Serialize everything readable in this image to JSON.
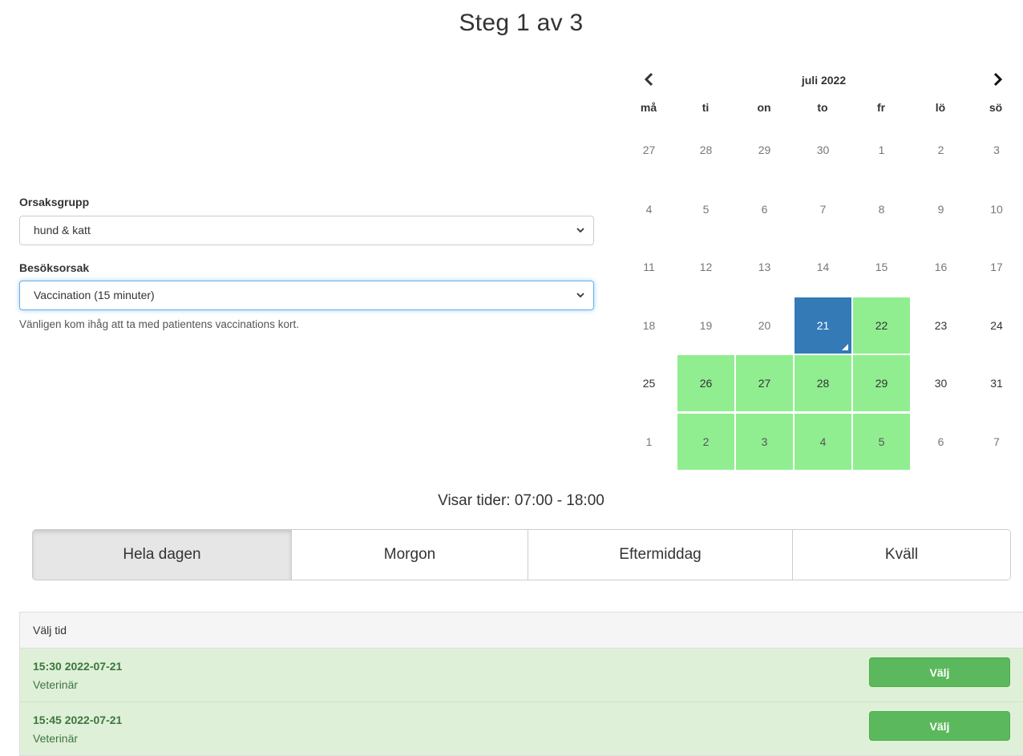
{
  "page": {
    "title": "Steg 1 av 3"
  },
  "form": {
    "group_label": "Orsaksgrupp",
    "group_value": "hund & katt",
    "reason_label": "Besöksorsak",
    "reason_value": "Vaccination (15 minuter)",
    "help_text": "Vänligen kom ihåg att ta med patientens vaccinations kort."
  },
  "calendar": {
    "month": "juli 2022",
    "prev_icon": "chevron-left-icon",
    "next_icon": "chevron-right-icon",
    "weekdays": [
      "må",
      "ti",
      "on",
      "to",
      "fr",
      "lö",
      "sö"
    ],
    "weeks": [
      [
        {
          "d": "27",
          "s": "other"
        },
        {
          "d": "28",
          "s": "other"
        },
        {
          "d": "29",
          "s": "other"
        },
        {
          "d": "30",
          "s": "other"
        },
        {
          "d": "1",
          "s": "other"
        },
        {
          "d": "2",
          "s": "other"
        },
        {
          "d": "3",
          "s": "other"
        }
      ],
      [
        {
          "d": "4",
          "s": "other"
        },
        {
          "d": "5",
          "s": "other"
        },
        {
          "d": "6",
          "s": "other"
        },
        {
          "d": "7",
          "s": "other"
        },
        {
          "d": "8",
          "s": "other"
        },
        {
          "d": "9",
          "s": "other"
        },
        {
          "d": "10",
          "s": "other"
        }
      ],
      [
        {
          "d": "11",
          "s": "other"
        },
        {
          "d": "12",
          "s": "other"
        },
        {
          "d": "13",
          "s": "other"
        },
        {
          "d": "14",
          "s": "other"
        },
        {
          "d": "15",
          "s": "other"
        },
        {
          "d": "16",
          "s": "other"
        },
        {
          "d": "17",
          "s": "other"
        }
      ],
      [
        {
          "d": "18",
          "s": "other"
        },
        {
          "d": "19",
          "s": "other"
        },
        {
          "d": "20",
          "s": "other"
        },
        {
          "d": "21",
          "s": "selected"
        },
        {
          "d": "22",
          "s": "avail"
        },
        {
          "d": "23",
          "s": "cur"
        },
        {
          "d": "24",
          "s": "cur"
        }
      ],
      [
        {
          "d": "25",
          "s": "cur"
        },
        {
          "d": "26",
          "s": "avail"
        },
        {
          "d": "27",
          "s": "avail"
        },
        {
          "d": "28",
          "s": "avail"
        },
        {
          "d": "29",
          "s": "avail"
        },
        {
          "d": "30",
          "s": "cur"
        },
        {
          "d": "31",
          "s": "cur"
        }
      ],
      [
        {
          "d": "1",
          "s": "other"
        },
        {
          "d": "2",
          "s": "avail other"
        },
        {
          "d": "3",
          "s": "avail other"
        },
        {
          "d": "4",
          "s": "avail other"
        },
        {
          "d": "5",
          "s": "avail other"
        },
        {
          "d": "6",
          "s": "other"
        },
        {
          "d": "7",
          "s": "other"
        }
      ]
    ],
    "colors": {
      "available": "#90ee90",
      "selected": "#337ab7"
    }
  },
  "times": {
    "showing": "Visar tider: 07:00 - 18:00",
    "filters": [
      {
        "label": "Hela dagen",
        "active": true
      },
      {
        "label": "Morgon",
        "active": false
      },
      {
        "label": "Eftermiddag",
        "active": false
      },
      {
        "label": "Kväll",
        "active": false
      }
    ]
  },
  "slots": {
    "header": "Välj tid",
    "items": [
      {
        "time": "15:30 2022-07-21",
        "role": "Veterinär",
        "button": "Välj"
      },
      {
        "time": "15:45 2022-07-21",
        "role": "Veterinär",
        "button": "Välj"
      }
    ]
  }
}
